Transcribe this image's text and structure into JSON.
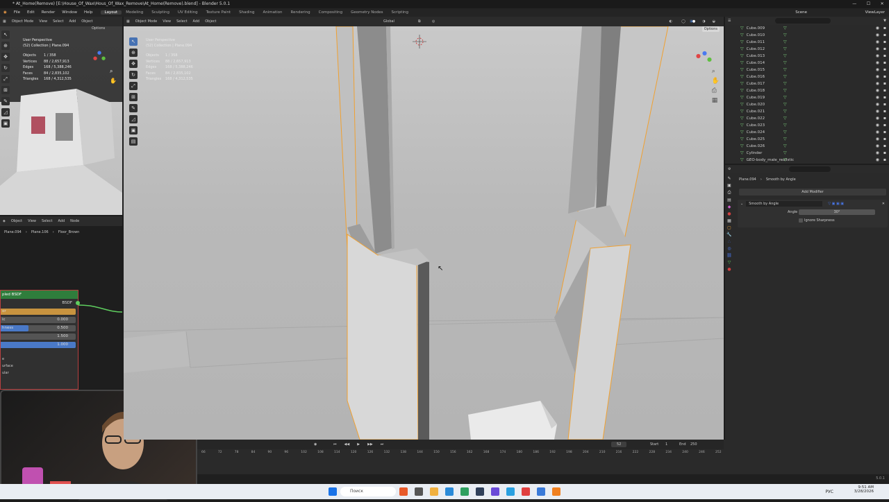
{
  "window": {
    "title": "* At_Home(Remove) [E:\\House_Of_Wax\\Hous_Of_Wax_Remove\\At_Home(Remove).blend] - Blender 5.0.1"
  },
  "menu": [
    "File",
    "Edit",
    "Render",
    "Window",
    "Help"
  ],
  "workspaces": [
    "Layout",
    "Modeling",
    "Sculpting",
    "UV Editing",
    "Texture Paint",
    "Shading",
    "Animation",
    "Rendering",
    "Compositing",
    "Geometry Nodes",
    "Scripting"
  ],
  "active_workspace": "Layout",
  "scene": {
    "label": "Scene",
    "view_layer": "ViewLayer"
  },
  "left_viewport": {
    "mode": "Object Mode",
    "menus": [
      "View",
      "Select",
      "Add",
      "Object"
    ],
    "options": "Options",
    "perspective": "User Perspective",
    "collection": "(52) Collection | Plane.094",
    "stats": [
      {
        "label": "Objects",
        "value": "1 / 358"
      },
      {
        "label": "Vertices",
        "value": "88 / 2,657,913"
      },
      {
        "label": "Edges",
        "value": "168 / 5,388,246"
      },
      {
        "label": "Faces",
        "value": "84 / 2,835,102"
      },
      {
        "label": "Triangles",
        "value": "168 / 4,312,535"
      }
    ]
  },
  "main_viewport": {
    "mode": "Object Mode",
    "menus": [
      "View",
      "Select",
      "Add",
      "Object"
    ],
    "orientation": "Global",
    "options": "Options",
    "perspective": "User Perspective",
    "collection": "(52) Collection | Plane.094",
    "stats": [
      {
        "label": "Objects",
        "value": "1 / 358"
      },
      {
        "label": "Vertices",
        "value": "88 / 2,657,913"
      },
      {
        "label": "Edges",
        "value": "168 / 5,388,246"
      },
      {
        "label": "Faces",
        "value": "84 / 2,835,102"
      },
      {
        "label": "Triangles",
        "value": "168 / 4,312,535"
      }
    ]
  },
  "node_editor": {
    "mode": "Object",
    "menus": [
      "View",
      "Select",
      "Add",
      "Node"
    ],
    "breadcrumb": [
      "Plane.094",
      "Plane.106",
      "Floor_Brown"
    ],
    "node_title": "pled BSDF",
    "output": "BSDF",
    "rows": [
      {
        "label": "or",
        "value": "",
        "fill": 1.0,
        "color": "#c8933f"
      },
      {
        "label": "ic",
        "value": "0.000",
        "fill": 0.0,
        "color": "#4a79c7"
      },
      {
        "label": "hness",
        "value": "0.500",
        "fill": 0.5,
        "color": "#4a79c7"
      },
      {
        "label": "",
        "value": "1.500",
        "fill": 0.0,
        "color": "#4a79c7"
      },
      {
        "label": "",
        "value": "1.000",
        "fill": 1.0,
        "color": "#4a79c7"
      }
    ],
    "extra_labels": [
      "e",
      "urface",
      "ular"
    ]
  },
  "outliner": {
    "search_placeholder": "",
    "items": [
      "Cube.009",
      "Cube.010",
      "Cube.011",
      "Cube.012",
      "Cube.013",
      "Cube.014",
      "Cube.015",
      "Cube.016",
      "Cube.017",
      "Cube.018",
      "Cube.019",
      "Cube.020",
      "Cube.021",
      "Cube.022",
      "Cube.023",
      "Cube.024",
      "Cube.025",
      "Cube.026",
      "Cylinder",
      "GEO-body_male_realistic"
    ]
  },
  "properties": {
    "object": "Plane.094",
    "modifier_name": "Smooth by Angle",
    "add_modifier": "Add Modifier",
    "modifier_panel": "Smooth by Angle",
    "angle_label": "Angle",
    "angle_value": "30°",
    "ignore_sharpness": "Ignore Sharpness"
  },
  "timeline": {
    "current_frame": "52",
    "start_label": "Start",
    "start": "1",
    "end_label": "End",
    "end": "250",
    "ticks": [
      "66",
      "72",
      "78",
      "84",
      "90",
      "96",
      "102",
      "108",
      "114",
      "120",
      "126",
      "132",
      "138",
      "144",
      "150",
      "156",
      "162",
      "168",
      "174",
      "180",
      "186",
      "192",
      "198",
      "204",
      "210",
      "216",
      "222",
      "228",
      "234",
      "240",
      "246",
      "252"
    ]
  },
  "taskbar": {
    "search": "Поиск",
    "lang": "РУС",
    "time": "9:51 AM",
    "date": "3/28/2026",
    "version": "5.0.1"
  },
  "colors": {
    "selection": "#f0a030",
    "accent": "#4772b3",
    "node_header": "#2f7d3c"
  }
}
